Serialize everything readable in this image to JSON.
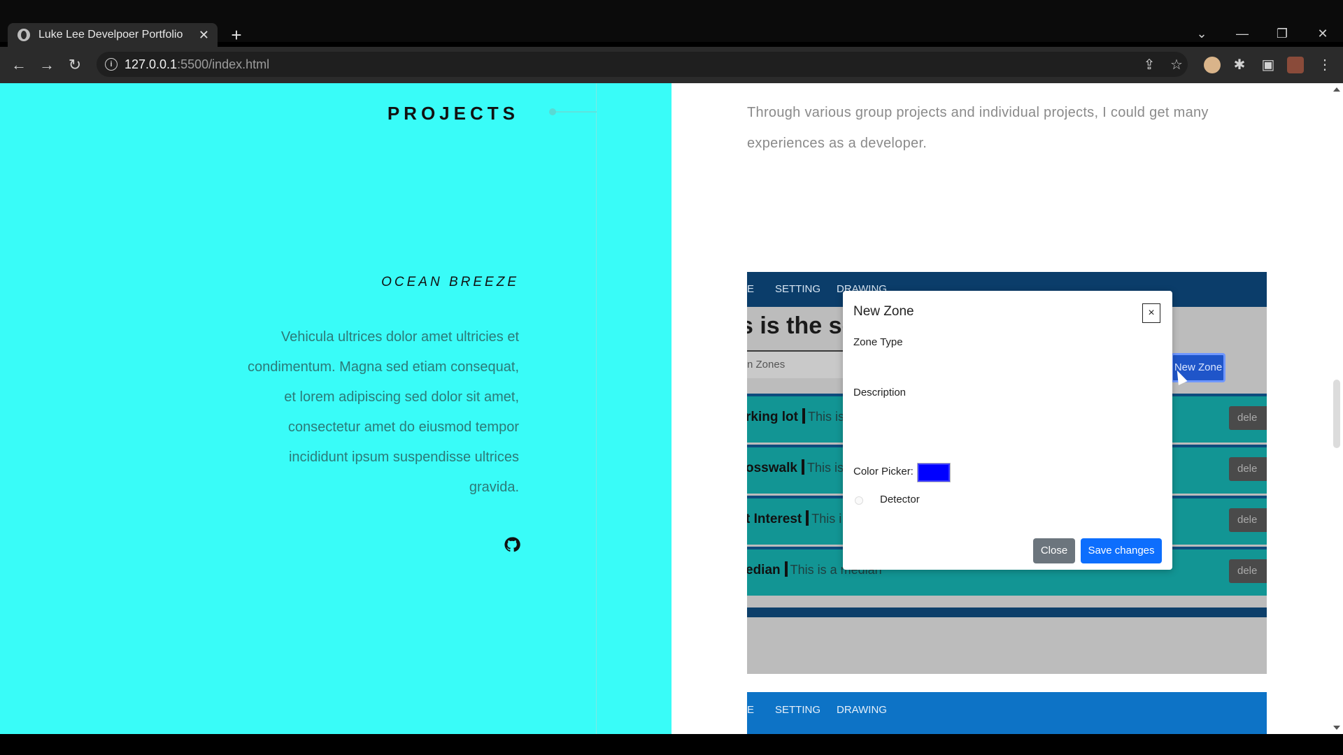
{
  "browser": {
    "tab_title": "Luke Lee Develpoer Portfolio",
    "tab_close": "✕",
    "new_tab": "+",
    "url_host": "127.0.0.1",
    "url_path": ":5500/index.html",
    "icons": [
      "back-icon",
      "forward-icon",
      "reload-icon",
      "info-icon",
      "share-icon",
      "star-icon",
      "extension-icon",
      "puzzle-icon",
      "sidepanel-icon",
      "profile-icon",
      "menu-icon"
    ]
  },
  "page": {
    "section_title": "PROJECTS",
    "intro": "Through various group projects and individual projects, I could get many experiences as a developer.",
    "project": {
      "name": "OCEAN BREEZE",
      "description": "Vehicula ultrices dolor amet ultricies et condimentum. Magna sed etiam consequat, et lorem adipiscing sed dolor sit amet, consectetur amet do eiusmod tempor incididunt ipsum suspendisse ultrices gravida."
    },
    "accent_color": "#39fcf8"
  },
  "shot": {
    "nav": [
      "E",
      "SETTING",
      "DRAWING"
    ],
    "heading": "s is the se",
    "search_placeholder": "n Zones",
    "new_zone_button": "New Zone",
    "rows": [
      {
        "name": "rking lot",
        "desc": "This is",
        "del": "dele"
      },
      {
        "name": "osswalk",
        "desc": "This is a",
        "del": "dele"
      },
      {
        "name": "t Interest",
        "desc": "This i",
        "del": "dele"
      },
      {
        "name": "edian",
        "desc": "This is a median",
        "del": "dele"
      }
    ]
  },
  "modal": {
    "title": "New Zone",
    "close_x": "×",
    "zone_type_label": "Zone Type",
    "description_label": "Description",
    "color_picker_label": "Color Picker:",
    "color_value": "#0000ff",
    "detector_label": "Detector",
    "close_button": "Close",
    "save_button": "Save changes"
  },
  "shot2": {
    "nav": [
      "E",
      "SETTING",
      "DRAWING"
    ]
  }
}
